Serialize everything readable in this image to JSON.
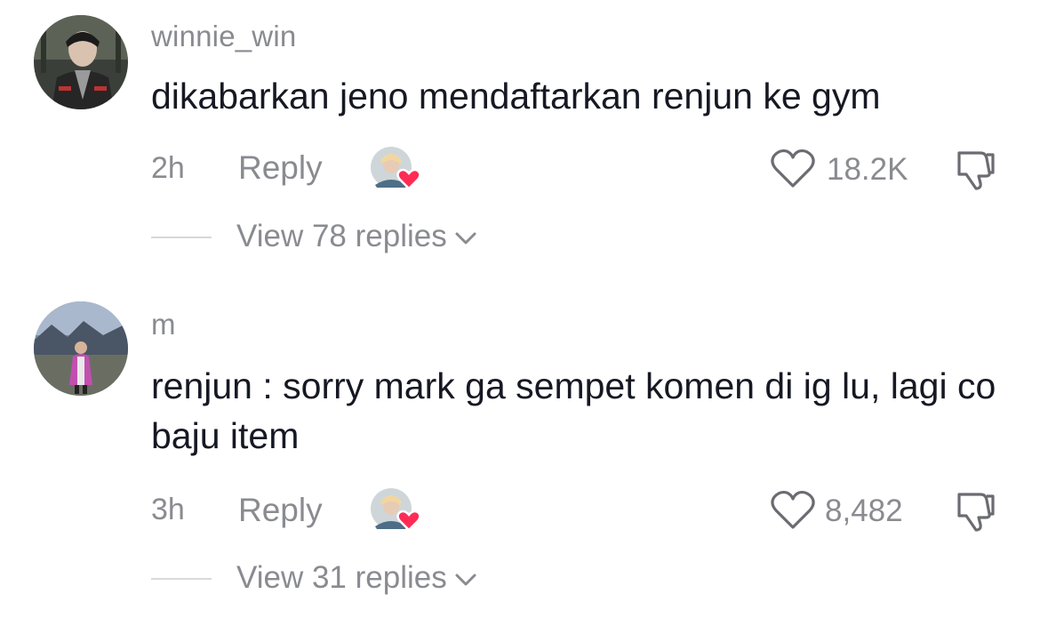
{
  "comments": [
    {
      "username": "winnie_win",
      "text": "dikabarkan jeno mendaftarkan renjun ke gym",
      "time": "2h",
      "reply_label": "Reply",
      "likes": "18.2K",
      "view_replies": "View 78 replies"
    },
    {
      "username": "m",
      "text": "renjun : sorry mark ga sempet komen di ig lu, lagi co baju item",
      "time": "3h",
      "reply_label": "Reply",
      "likes": "8,482",
      "view_replies": "View 31 replies"
    }
  ],
  "colors": {
    "text": "#161823",
    "secondary": "#8a8b91",
    "heart_badge": "#fe2c55"
  },
  "icons": [
    "heart-outline-icon",
    "thumbs-down-icon",
    "chevron-down-icon",
    "creator-liked-badge-icon"
  ]
}
